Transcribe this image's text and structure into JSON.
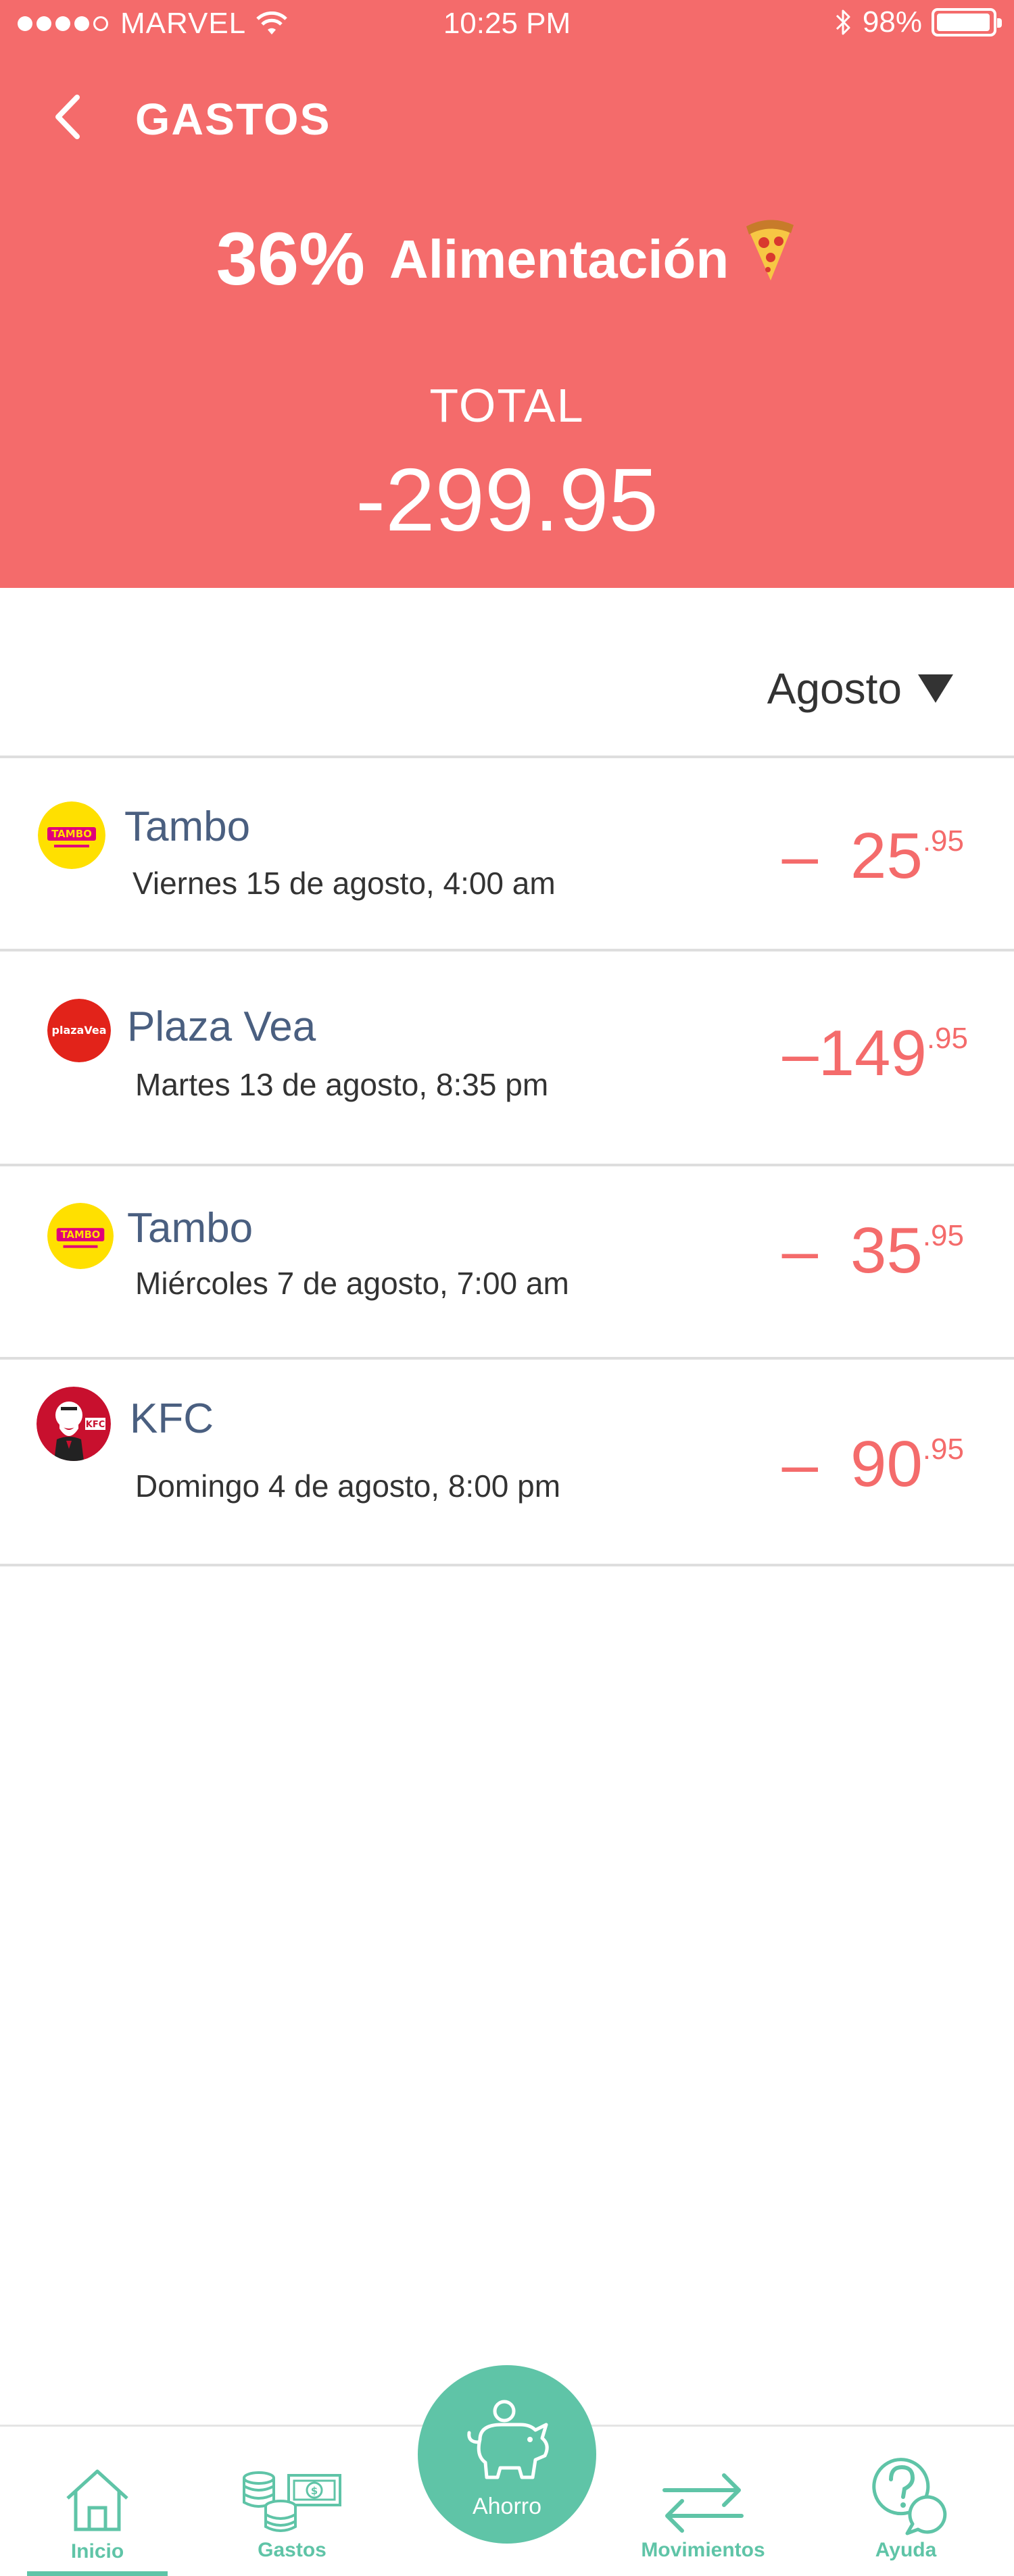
{
  "status_bar": {
    "carrier": "MARVEL",
    "time": "10:25 PM",
    "battery": "98%",
    "battery_level": 0.98
  },
  "header": {
    "title": "GASTOS",
    "category_percent": "36%",
    "category_name": "Alimentación",
    "category_icon": "pizza-icon",
    "total_label": "TOTAL",
    "total_value": "-299.95"
  },
  "filter": {
    "month": "Agosto"
  },
  "transactions": [
    {
      "merchant": "Tambo",
      "date": "Viernes 15 de agosto, 4:00 am",
      "sign": "–",
      "amount_int": "25",
      "amount_dec": ".95",
      "logo": "tambo-logo"
    },
    {
      "merchant": "Plaza Vea",
      "date": "Martes 13 de agosto, 8:35 pm",
      "sign": "–",
      "amount_int": "149",
      "amount_dec": ".95",
      "logo": "plazavea-logo",
      "logo_text": "plazaVea"
    },
    {
      "merchant": "Tambo",
      "date": "Miércoles 7 de agosto, 7:00 am",
      "sign": "–",
      "amount_int": "35",
      "amount_dec": ".95",
      "logo": "tambo-logo"
    },
    {
      "merchant": "KFC",
      "date": "Domingo 4 de agosto, 8:00 pm",
      "sign": "–",
      "amount_int": "90",
      "amount_dec": ".95",
      "logo": "kfc-logo"
    }
  ],
  "tabbar": {
    "items": [
      {
        "label": "Inicio",
        "icon": "home-icon",
        "active": true
      },
      {
        "label": "Gastos",
        "icon": "money-icon",
        "active": false
      },
      {
        "label": "Ahorro",
        "icon": "piggy-bank-icon",
        "active": false
      },
      {
        "label": "Movimientos",
        "icon": "transfer-arrows-icon",
        "active": false
      },
      {
        "label": "Ayuda",
        "icon": "help-chat-icon",
        "active": false
      }
    ]
  },
  "colors": {
    "header_bg": "#f46b6b",
    "amount": "#f46b6b",
    "merchant": "#4a5f80",
    "accent": "#5fc4a7"
  }
}
